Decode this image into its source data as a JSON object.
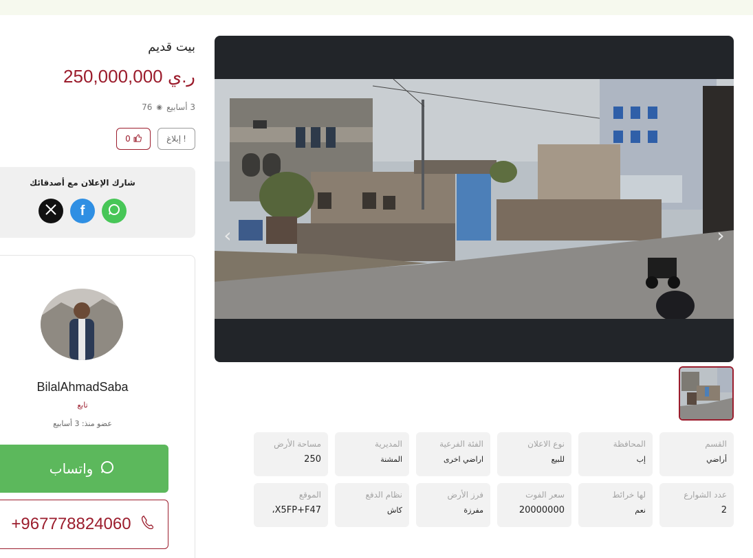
{
  "listing": {
    "title": "بيت قديم",
    "price": "250,000,000 ر.ي",
    "age": "3 أسابيع",
    "views": "76",
    "likes": "0",
    "report_label": "إبلاغ"
  },
  "share": {
    "title": "شارك الإعلان مع أصدقائك"
  },
  "seller": {
    "name": "BilalAhmadSaba",
    "type": "تابع",
    "member_since": "عضو منذ: 3 أسابيع"
  },
  "contact": {
    "whatsapp_label": "واتساب",
    "phone": "+967778824060"
  },
  "gallery": {
    "prev_icon": "‹",
    "next_icon": "›"
  },
  "specs": [
    {
      "key": "القسم",
      "value": "أراضي"
    },
    {
      "key": "المحافظة",
      "value": "إب"
    },
    {
      "key": "نوع الاعلان",
      "value": "للبيع"
    },
    {
      "key": "الفئة الفرعية",
      "value": "اراضي اخرى"
    },
    {
      "key": "المديرية",
      "value": "المشنة"
    },
    {
      "key": "مساحة الأرض",
      "value": "250"
    },
    {
      "key": "عدد الشوارع",
      "value": "2"
    },
    {
      "key": "لها خرائط",
      "value": "نعم"
    },
    {
      "key": "سعر الفوت",
      "value": "20000000"
    },
    {
      "key": "فرز الأرض",
      "value": "مفرزة"
    },
    {
      "key": "نظام الدفع",
      "value": "كاش"
    },
    {
      "key": "الموقع",
      "value": "X5FP+F47،"
    }
  ],
  "colors": {
    "accent": "#9b1c2c",
    "whatsapp": "#5cb85c",
    "facebook": "#2f8fe3",
    "gallery_bg": "#222529"
  }
}
